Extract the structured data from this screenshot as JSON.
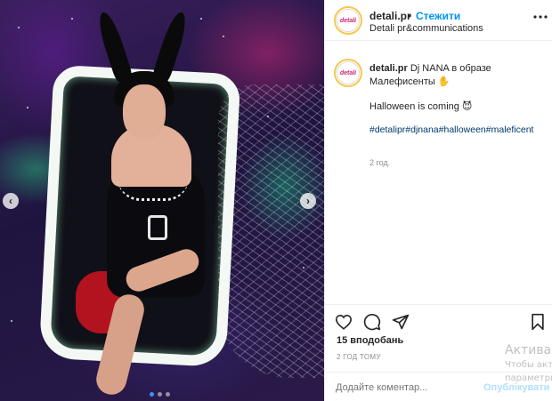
{
  "post": {
    "username": "detali.pr",
    "separator": "•",
    "follow_label": "Стежити",
    "subtitle": "Detali pr&communications",
    "avatar_text": "detali",
    "more_icon": "more-horizontal-icon",
    "caption": {
      "text": "Dj NANA в образе Малефисенты ✋",
      "line2": "Halloween is coming 😈",
      "hashtags": "#detalipr#djnana#halloween#maleficent",
      "age": "2 год."
    },
    "likes": "15 вподобань",
    "date": "2 ГОД ТОМУ",
    "comment_placeholder": "Додайте коментар...",
    "post_label": "Опублікувати"
  },
  "carousel": {
    "prev_label": "‹",
    "next_label": "›",
    "slides": 3,
    "active_slide": 1
  },
  "watermark": {
    "line1": "Активац",
    "line2": "Чтобы акт",
    "line3": "параметры"
  },
  "icons": [
    "heart-icon",
    "comment-icon",
    "share-icon",
    "bookmark-icon",
    "more-horizontal-icon"
  ]
}
